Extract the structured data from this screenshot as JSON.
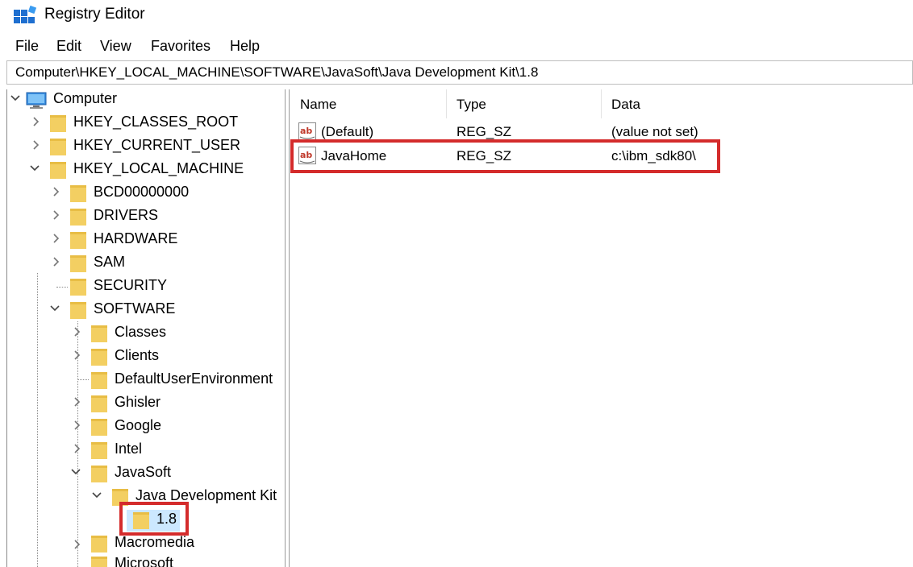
{
  "window": {
    "title": "Registry Editor"
  },
  "menu": [
    "File",
    "Edit",
    "View",
    "Favorites",
    "Help"
  ],
  "address": "Computer\\HKEY_LOCAL_MACHINE\\SOFTWARE\\JavaSoft\\Java Development Kit\\1.8",
  "tree": {
    "root": "Computer",
    "hives": {
      "classes_root": "HKEY_CLASSES_ROOT",
      "current_user": "HKEY_CURRENT_USER",
      "local_machine": "HKEY_LOCAL_MACHINE"
    },
    "local_machine_children": {
      "bcd": "BCD00000000",
      "drivers": "DRIVERS",
      "hardware": "HARDWARE",
      "sam": "SAM",
      "security": "SECURITY",
      "software": "SOFTWARE"
    },
    "software_children": {
      "classes": "Classes",
      "clients": "Clients",
      "default_user_env": "DefaultUserEnvironment",
      "ghisler": "Ghisler",
      "google": "Google",
      "intel": "Intel",
      "javasoft": "JavaSoft",
      "macromedia": "Macromedia",
      "microsoft": "Microsoft"
    },
    "javasoft_children": {
      "jdk": "Java Development Kit"
    },
    "jdk_children": {
      "version": "1.8"
    }
  },
  "list": {
    "columns": {
      "name": "Name",
      "type": "Type",
      "data": "Data"
    },
    "rows": [
      {
        "name": "(Default)",
        "type": "REG_SZ",
        "data": "(value not set)"
      },
      {
        "name": "JavaHome",
        "type": "REG_SZ",
        "data": "c:\\ibm_sdk80\\"
      }
    ]
  },
  "colors": {
    "highlight": "#d42b2b",
    "folder": "#f3cf62",
    "selection": "#cce8ff"
  }
}
